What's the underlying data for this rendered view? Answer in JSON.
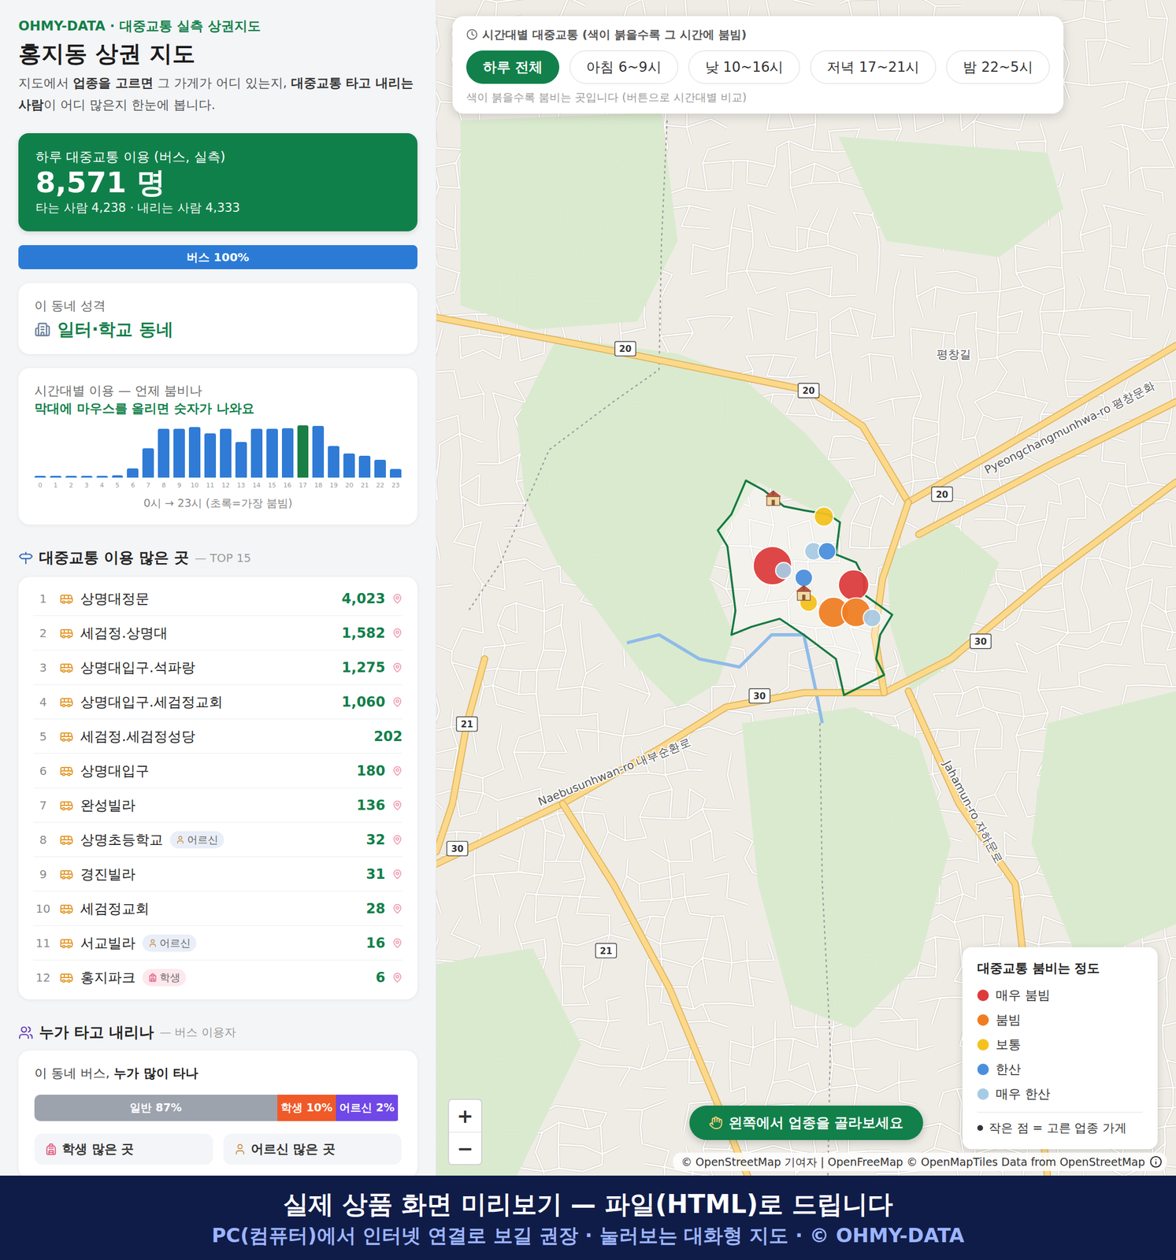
{
  "brand": "OHMY-DATA · 대중교통 실측 상권지도",
  "title": "홍지동 상권 지도",
  "description": [
    {
      "text": "지도에서 ",
      "bold": false
    },
    {
      "text": "업종을 고르면",
      "bold": true
    },
    {
      "text": " 그 가게가 어디 있는지, ",
      "bold": false
    },
    {
      "text": "대중교통 타고 내리는 사람",
      "bold": true
    },
    {
      "text": "이 어디 많은지 한눈에 봅니다.",
      "bold": false
    }
  ],
  "summary": {
    "label": "하루 대중교통 이용 (버스, 실측)",
    "value": "8,571 명",
    "detail": "타는 사람 4,238 · 내리는 사람 4,333"
  },
  "mode_bar": {
    "label": "버스 100%",
    "level": 1
  },
  "character": {
    "label": "이 동네 성격",
    "value": "일터·학교 동네"
  },
  "hourly": {
    "title": "시간대별 이용 — 언제 붐비나",
    "hint": "막대에 마우스를 올리면 숫자가 나와요",
    "values": [
      15,
      12,
      10,
      10,
      14,
      30,
      118,
      372,
      617,
      617,
      640,
      558,
      617,
      450,
      617,
      617,
      627,
      660,
      650,
      402,
      304,
      274,
      225,
      108
    ],
    "ticks": [
      "0",
      "1",
      "2",
      "3",
      "4",
      "5",
      "6",
      "7",
      "8",
      "9",
      "10",
      "11",
      "12",
      "13",
      "14",
      "15",
      "16",
      "17",
      "18",
      "19",
      "20",
      "21",
      "22",
      "23"
    ],
    "caption": "0시 → 23시 (초록=가장 붐빔)"
  },
  "top_section": {
    "title": "대중교통 이용 많은 곳",
    "suffix": "— TOP 15"
  },
  "stops": [
    {
      "rank": "1",
      "name": "상명대정문",
      "count": "4,023",
      "pin": true
    },
    {
      "rank": "2",
      "name": "세검정.상명대",
      "count": "1,582",
      "pin": true
    },
    {
      "rank": "3",
      "name": "상명대입구.석파랑",
      "count": "1,275",
      "pin": true
    },
    {
      "rank": "4",
      "name": "상명대입구.세검정교회",
      "count": "1,060",
      "pin": true
    },
    {
      "rank": "5",
      "name": "세검정.세검정성당",
      "count": "202",
      "pin": false
    },
    {
      "rank": "6",
      "name": "상명대입구",
      "count": "180",
      "pin": true
    },
    {
      "rank": "7",
      "name": "완성빌라",
      "count": "136",
      "pin": true
    },
    {
      "rank": "8",
      "name": "상명초등학교",
      "count": "32",
      "pin": true,
      "badge": {
        "label": "어르신",
        "kind": "elder",
        "color": "#e9eef8"
      }
    },
    {
      "rank": "9",
      "name": "경진빌라",
      "count": "31",
      "pin": true
    },
    {
      "rank": "10",
      "name": "세검정교회",
      "count": "28",
      "pin": true
    },
    {
      "rank": "11",
      "name": "서교빌라",
      "count": "16",
      "pin": true,
      "badge": {
        "label": "어르신",
        "kind": "elder",
        "color": "#e9eef8"
      }
    },
    {
      "rank": "12",
      "name": "홍지파크",
      "count": "6",
      "pin": true,
      "badge": {
        "label": "학생",
        "kind": "student",
        "color": "#fde8ee"
      }
    }
  ],
  "riders_section": {
    "title": "누가 타고 내리나",
    "suffix": "— 버스 이용자"
  },
  "riders": {
    "title_plain": "이 동네 버스, ",
    "title_bold": "누가 많이 타나",
    "segments": [
      {
        "label": "일반 87%",
        "level": 0.87,
        "color": "#9ca3ad"
      },
      {
        "label": "학생 10%",
        "level": 0.1,
        "color": "#f05a28"
      },
      {
        "label": "어르신 2%",
        "level": 0.02,
        "color": "#7048e8"
      }
    ],
    "groups": [
      {
        "label": "학생 많은 곳",
        "kind": "student"
      },
      {
        "label": "어르신 많은 곳",
        "kind": "elder"
      }
    ]
  },
  "map": {
    "time_filter": {
      "title": "시간대별 대중교통 (색이 붉을수록 그 시간에 붐빔)",
      "options": [
        {
          "label": "하루 전체",
          "selected": true
        },
        {
          "label": "아침 6~9시",
          "selected": false
        },
        {
          "label": "낮 10~16시",
          "selected": false
        },
        {
          "label": "저녁 17~21시",
          "selected": false
        },
        {
          "label": "밤 22~5시",
          "selected": false
        }
      ],
      "hint": "색이 붉을수록 붐비는 곳입니다 (버튼으로 시간대별 비교)"
    },
    "road_labels": [
      "Pyeongchangmunhwa-ro 평창문화",
      "Naebusunhwan-ro 내부순환로",
      "Jahamun-ro 자하문로"
    ],
    "place_labels": [
      "평창길"
    ],
    "shields": [
      "20",
      "20",
      "20",
      "30",
      "30",
      "30",
      "21",
      "21"
    ],
    "markers": [
      {
        "color": "#dd3b3b"
      },
      {
        "color": "#a8cbe4"
      },
      {
        "color": "#f4c21d"
      },
      {
        "color": "#a8cbe4"
      },
      {
        "color": "#4a8fdc"
      },
      {
        "color": "#4a8fdc"
      },
      {
        "color": "#f4c21d"
      },
      {
        "color": "#dd3b3b"
      },
      {
        "color": "#f07d22"
      },
      {
        "color": "#f07d22"
      },
      {
        "color": "#a8cbe4"
      }
    ],
    "legend": {
      "title": "대중교통 붐비는 정도",
      "items": [
        {
          "label": "매우 붐빔",
          "color": "#dd3b3b"
        },
        {
          "label": "붐빔",
          "color": "#f07d22"
        },
        {
          "label": "보통",
          "color": "#f4c21d"
        },
        {
          "label": "한산",
          "color": "#4a8fdc"
        },
        {
          "label": "매우 한산",
          "color": "#a8cbe4"
        }
      ],
      "note": "작은 점 = 고른 업종 가게"
    },
    "zoom": [
      "+",
      "−"
    ],
    "prompt": "왼쪽에서 업종을 골라보세요",
    "attribution": "© OpenStreetMap 기여자 | OpenFreeMap © OpenMapTiles Data from OpenStreetMap"
  },
  "banner": {
    "line1": "실제 상품 화면 미리보기 — 파일(HTML)로 드립니다",
    "line2": "PC(컴퓨터)에서 인터넷 연결로 보길 권장 · 눌러보는 대화형 지도 · © OHMY-DATA"
  }
}
